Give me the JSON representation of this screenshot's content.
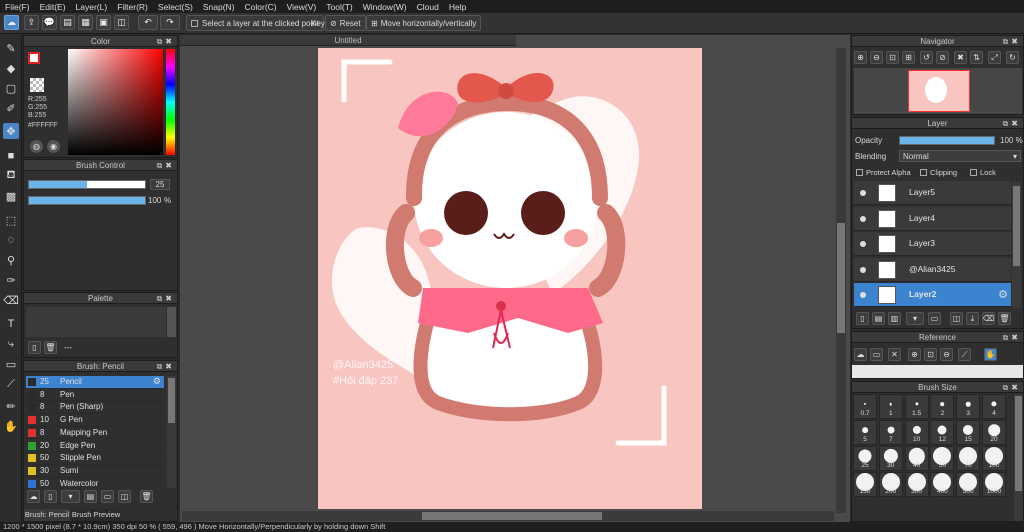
{
  "menu": [
    "File(F)",
    "Edit(E)",
    "Layer(L)",
    "Filter(R)",
    "Select(S)",
    "Snap(N)",
    "Color(C)",
    "View(V)",
    "Tool(T)",
    "Window(W)",
    "Cloud",
    "Help"
  ],
  "toolbar": {
    "select_layer_label": "Select a layer at the clicked point",
    "key_label": "Key",
    "reset_label": "Reset",
    "move_label": "Move horizontally/vertically"
  },
  "color_panel": {
    "title": "Color",
    "r": "R:255",
    "g": "G:255",
    "b": "B:255",
    "hex": "#FFFFFF"
  },
  "brush_control": {
    "title": "Brush Control",
    "size_value": "25",
    "opacity_value": "100",
    "opacity_unit": "%",
    "size_fraction": 0.5,
    "opacity_fraction": 1.0
  },
  "palette": {
    "title": "Palette",
    "ellipsis": "---"
  },
  "brush_list": {
    "title": "Brush: Pencil",
    "items": [
      {
        "size": "25",
        "name": "Pencil",
        "color": "#2a2a2a",
        "selected": true
      },
      {
        "size": "8",
        "name": "Pen",
        "color": "#2a2a2a"
      },
      {
        "size": "8",
        "name": "Pen (Sharp)",
        "color": "#2a2a2a"
      },
      {
        "size": "10",
        "name": "G Pen",
        "color": "#e03030"
      },
      {
        "size": "8",
        "name": "Mapping Pen",
        "color": "#e03030"
      },
      {
        "size": "20",
        "name": "Edge Pen",
        "color": "#30a030"
      },
      {
        "size": "50",
        "name": "Stipple Pen",
        "color": "#e0c020"
      },
      {
        "size": "30",
        "name": "Sumi",
        "color": "#e0c020"
      },
      {
        "size": "50",
        "name": "Watercolor",
        "color": "#3070d0"
      }
    ],
    "tabs": [
      "Brush: Pencil",
      "Brush Preview"
    ]
  },
  "canvas": {
    "doc_title": "Untitled",
    "watermark_line1": "@Alian3425",
    "watermark_line2": "#Hỏi đáp 237"
  },
  "navigator": {
    "title": "Navigator"
  },
  "layer_panel": {
    "title": "Layer",
    "opacity_label": "Opacity",
    "opacity_value": "100 %",
    "opacity_fraction": 1.0,
    "blending_label": "Blending",
    "blending_value": "Normal",
    "protect_alpha": "Protect Alpha",
    "clipping": "Clipping",
    "lock": "Lock",
    "layers": [
      {
        "name": "Layer5",
        "selected": false
      },
      {
        "name": "Layer4",
        "selected": false
      },
      {
        "name": "Layer3",
        "selected": false
      },
      {
        "name": "@Alian3425",
        "selected": false
      },
      {
        "name": "Layer2",
        "selected": true
      }
    ]
  },
  "reference": {
    "title": "Reference"
  },
  "brush_size": {
    "title": "Brush Size",
    "sizes": [
      "0.7",
      "1",
      "1.5",
      "2",
      "3",
      "4",
      "5",
      "7",
      "10",
      "12",
      "15",
      "20",
      "25",
      "30",
      "40",
      "50",
      "70",
      "100",
      "150",
      "200",
      "300",
      "400",
      "500",
      "1000"
    ]
  },
  "status": {
    "text": "1200 * 1500 pixel   (8.7 * 10.9cm)   350 dpi   50 %   ( 559, 496 )   Move Horizontally/Perpendicularly by holding down Shift"
  }
}
